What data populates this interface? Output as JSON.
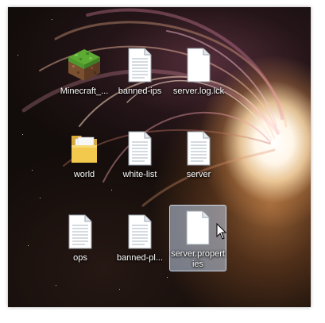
{
  "desktop": {
    "icons": [
      {
        "label": "Minecraft_...",
        "type": "minecraft-block"
      },
      {
        "label": "banned-ips",
        "type": "text-file"
      },
      {
        "label": "server.log.lck",
        "type": "blank-file"
      },
      {
        "label": "world",
        "type": "folder"
      },
      {
        "label": "white-list",
        "type": "text-file"
      },
      {
        "label": "server",
        "type": "text-file"
      },
      {
        "label": "ops",
        "type": "text-file"
      },
      {
        "label": "banned-pl...",
        "type": "text-file"
      },
      {
        "label": "server.properties",
        "type": "blank-file",
        "selected": true
      }
    ]
  },
  "colors": {
    "selection": "#bed2eb",
    "label_text": "#ffffff",
    "folder": "#f2c94c",
    "grass": "#4e9a2f",
    "dirt": "#8a5a36"
  }
}
